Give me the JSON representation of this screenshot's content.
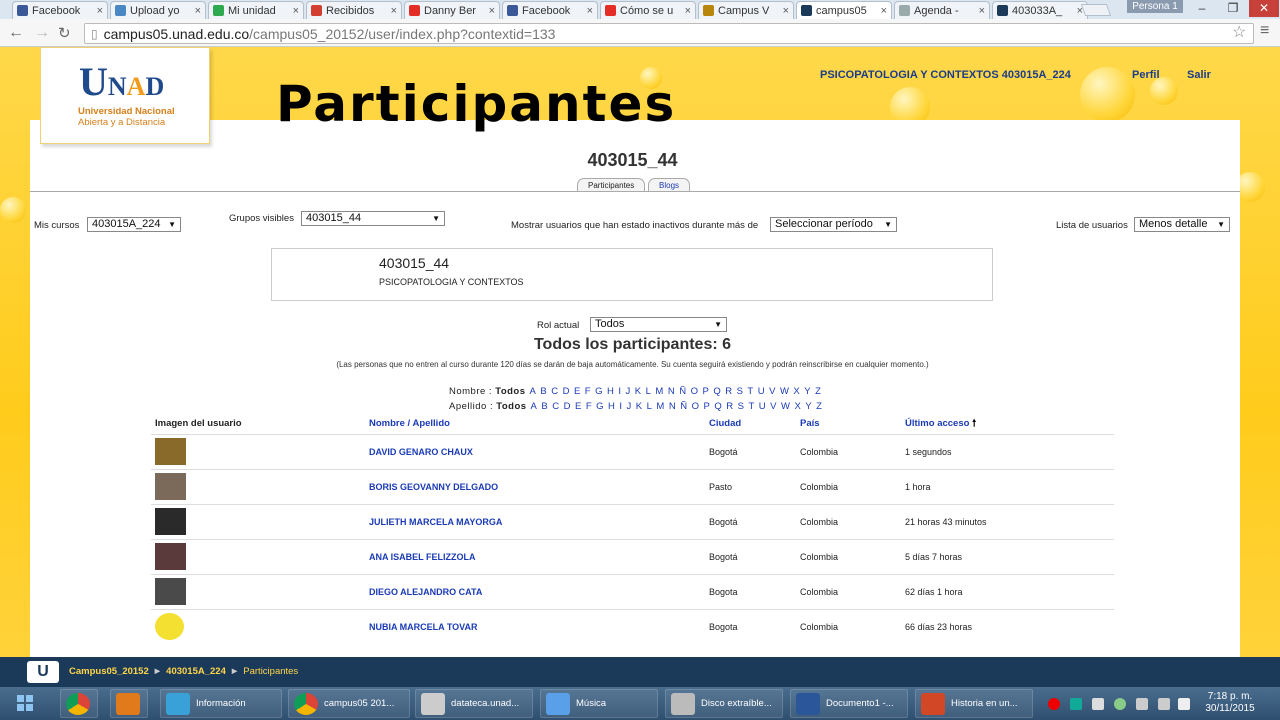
{
  "browser": {
    "tabs": [
      {
        "label": "Facebook",
        "icon": "facebook-icon",
        "color": "#3b5998"
      },
      {
        "label": "Upload yo",
        "icon": "upload-icon",
        "color": "#4a87c5"
      },
      {
        "label": "Mi unidad",
        "icon": "drive-icon",
        "color": "#2da94f"
      },
      {
        "label": "Recibidos",
        "icon": "gmail-icon",
        "color": "#d23f31"
      },
      {
        "label": "Danny Ber",
        "icon": "youtube-icon",
        "color": "#e52d27"
      },
      {
        "label": "Facebook",
        "icon": "facebook-icon",
        "color": "#3b5998"
      },
      {
        "label": "Cómo se u",
        "icon": "youtube-icon",
        "color": "#e52d27"
      },
      {
        "label": "Campus V",
        "icon": "campus-icon",
        "color": "#b8860b"
      },
      {
        "label": "campus05",
        "icon": "unad-icon",
        "color": "#1b3a5a"
      },
      {
        "label": "Agenda - ",
        "icon": "doc-icon",
        "color": "#9aa"
      },
      {
        "label": "403033A_",
        "icon": "unad-icon",
        "color": "#1b3a5a"
      }
    ],
    "close_glyph": "×",
    "persona": "Persona 1",
    "url_domain": "campus05.unad.edu.co",
    "url_path": "/campus05_20152/user/index.php?contextid=133"
  },
  "header": {
    "logo_text_u": "U",
    "logo_text_n": "N",
    "logo_text_a": "A",
    "logo_text_d": "D",
    "logo_line1": "Universidad Nacional",
    "logo_line2": "Abierta y a Distancia",
    "overlay_title": "Participantes",
    "course_link": "PSICOPATOLOGIA Y CONTEXTOS 403015A_224",
    "profile_link": "Perfil",
    "logout_link": "Salir"
  },
  "main": {
    "group_code": "403015_44",
    "tabs": [
      "Participantes",
      "Blogs"
    ],
    "my_courses_label": "Mis cursos",
    "my_courses_value": "403015A_224",
    "groups_label": "Grupos visibles",
    "groups_value": "403015_44",
    "inactive_label": "Mostrar usuarios que han estado inactivos durante más de",
    "inactive_value": "Seleccionar período",
    "userlist_label": "Lista de usuarios",
    "userlist_value": "Menos detalle",
    "info_code": "403015_44",
    "info_course": "PSICOPATOLOGIA Y CONTEXTOS",
    "role_label": "Rol actual",
    "role_value": "Todos",
    "all_participants": "Todos los participantes: 6",
    "note": "(Las personas que no entren al curso durante 120 días se darán de baja automáticamente. Su cuenta seguirá existiendo y podrán reinscribirse en cualquier momento.)",
    "first_name_label": "Nombre :",
    "last_name_label": "Apellido :",
    "all_label": "Todos",
    "letters": [
      "A",
      "B",
      "C",
      "D",
      "E",
      "F",
      "G",
      "H",
      "I",
      "J",
      "K",
      "L",
      "M",
      "N",
      "Ñ",
      "O",
      "P",
      "Q",
      "R",
      "S",
      "T",
      "U",
      "V",
      "W",
      "X",
      "Y",
      "Z"
    ]
  },
  "table": {
    "headers": {
      "image": "Imagen del usuario",
      "name": "Nombre / Apellido",
      "city": "Ciudad",
      "country": "País",
      "access": "Último acceso"
    },
    "rows": [
      {
        "name": "DAVID GENARO CHAUX",
        "city": "Bogotá",
        "country": "Colombia",
        "access": "1 segundos",
        "avatar": "#8a6a2a"
      },
      {
        "name": "BORIS GEOVANNY DELGADO",
        "city": "Pasto",
        "country": "Colombia",
        "access": "1 hora",
        "avatar": "#7b6a5a"
      },
      {
        "name": "JULIETH MARCELA MAYORGA",
        "city": "Bogotá",
        "country": "Colombia",
        "access": "21 horas 43 minutos",
        "avatar": "#2a2a2a"
      },
      {
        "name": "ANA ISABEL FELIZZOLA",
        "city": "Bogotá",
        "country": "Colombia",
        "access": "5 días 7 horas",
        "avatar": "#5a3a3a"
      },
      {
        "name": "DIEGO ALEJANDRO CATA",
        "city": "Bogota",
        "country": "Colombia",
        "access": "62 días 1 hora",
        "avatar": "#4a4a4a"
      },
      {
        "name": "NUBIA MARCELA TOVAR",
        "city": "Bogota",
        "country": "Colombia",
        "access": "66 días 23 horas",
        "avatar": "#f4e030"
      }
    ]
  },
  "footer": {
    "breadcrumb": [
      "Campus05_20152",
      "403015A_224",
      "Participantes"
    ],
    "sep": "►"
  },
  "taskbar": {
    "items": [
      {
        "label": "",
        "icon": "chrome-icon",
        "color": "#e0e0e0"
      },
      {
        "label": "",
        "icon": "media-player-icon",
        "color": "#e07a1a"
      },
      {
        "label": "Información",
        "icon": "network-icon",
        "color": "#3aa0d8"
      },
      {
        "label": "campus05 201...",
        "icon": "chrome-icon",
        "color": "#e0e0e0"
      },
      {
        "label": "datateca.unad...",
        "icon": "document-icon",
        "color": "#cccccc"
      },
      {
        "label": "Música",
        "icon": "music-icon",
        "color": "#5aa0e8"
      },
      {
        "label": "Disco extraíble...",
        "icon": "usb-drive-icon",
        "color": "#bbbbbb"
      },
      {
        "label": "Documento1 -...",
        "icon": "word-icon",
        "color": "#2b579a"
      },
      {
        "label": "Historia en un...",
        "icon": "powerpoint-icon",
        "color": "#d24726"
      }
    ],
    "time": "7:18 p. m.",
    "date": "30/11/2015"
  }
}
